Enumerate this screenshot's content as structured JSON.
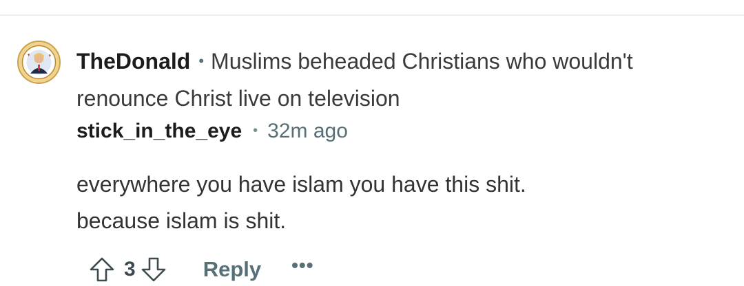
{
  "post": {
    "community": "TheDonald",
    "separator": "•",
    "title": "Muslims beheaded Christians who wouldn't renounce Christ live on television"
  },
  "comment": {
    "author": "stick_in_the_eye",
    "separator": "•",
    "time": "32m ago",
    "body": [
      "everywhere you have islam you have this shit.",
      "because islam is shit."
    ]
  },
  "actions": {
    "upvote_icon": "arrow-up-outline-icon",
    "vote_count": "3",
    "downvote_icon": "arrow-down-outline-icon",
    "reply_label": "Reply",
    "more_label": "•••"
  },
  "avatar": {
    "icon": "presidential-seal-avatar"
  },
  "colors": {
    "text_primary": "#1c1c1c",
    "text_secondary": "#576f76",
    "divider": "#edeff1"
  }
}
